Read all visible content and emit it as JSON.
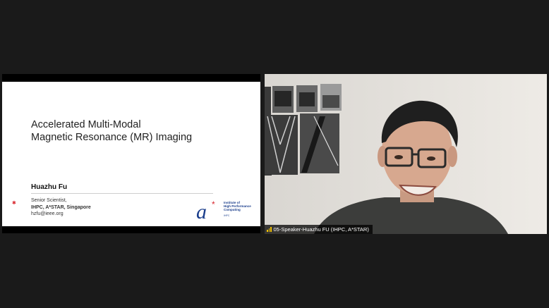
{
  "shared_slide": {
    "title_line1": "Accelerated Multi-Modal",
    "title_line2": "Magnetic Resonance (MR) Imaging",
    "author": "Huazhu Fu",
    "position": "Senior Scientist,",
    "affiliation": "IHPC, A*STAR, Singapore",
    "email": "hzfu@ieee.org",
    "logo_line1": "Institute of",
    "logo_line2": "High Performance",
    "logo_line3": "Computing",
    "logo_sub": "IHPC"
  },
  "video": {
    "participant_name": "05-Speaker-Huazhu FU (IHPC, A*STAR)"
  },
  "colors": {
    "background": "#1a1a1a",
    "astar_blue": "#1b3e8c",
    "astar_red": "#d8262e",
    "mic_active": "#f2c200"
  }
}
